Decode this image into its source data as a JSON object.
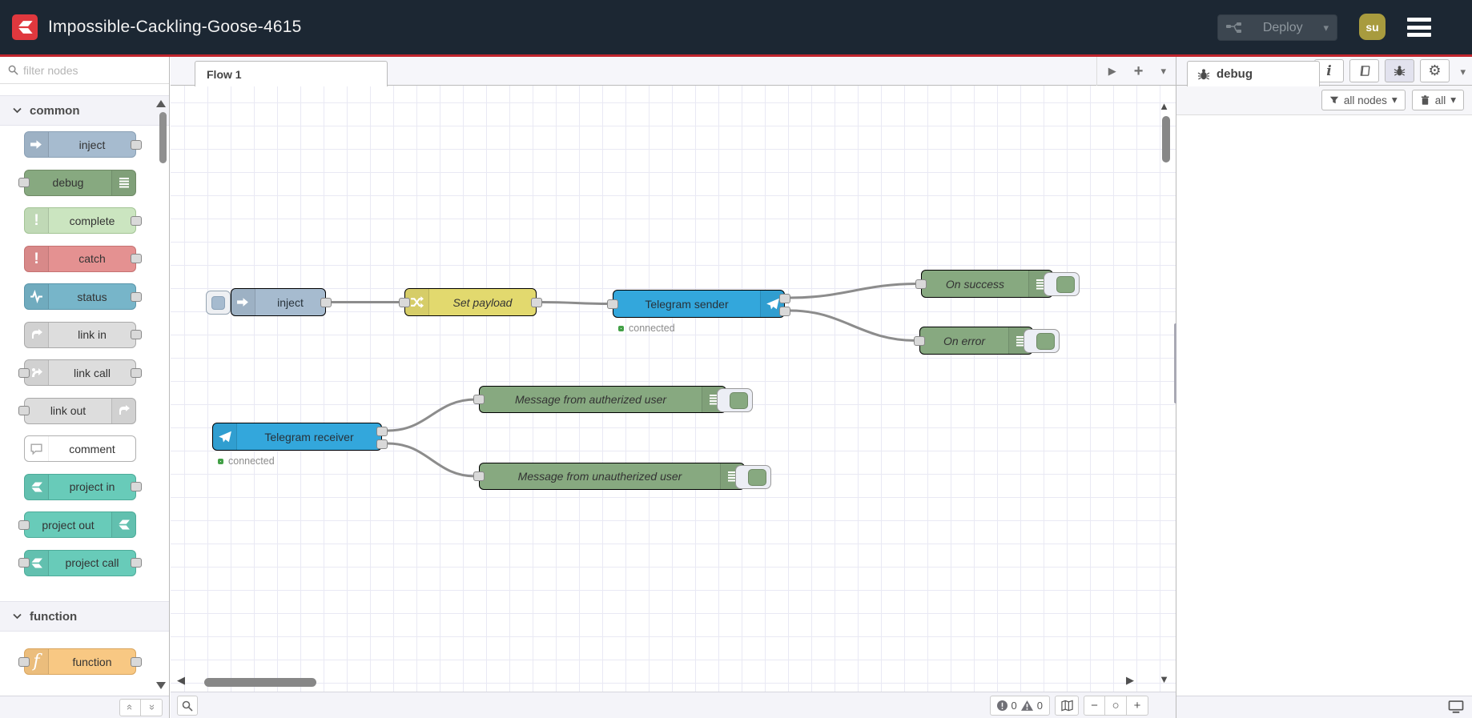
{
  "header": {
    "title": "Impossible-Cackling-Goose-4615",
    "deploy": {
      "label": "Deploy"
    },
    "user": {
      "initials": "su"
    },
    "colors": {
      "background": "#1c2733",
      "accent_line": "#c1252d",
      "logo_red": "#e0383e",
      "avatar": "#a89b3e"
    }
  },
  "palette": {
    "filter": {
      "placeholder": "filter nodes"
    },
    "sections": [
      {
        "label": "common",
        "items": [
          {
            "label": "inject",
            "color": "#a6bbcf"
          },
          {
            "label": "debug",
            "color": "#87a980"
          },
          {
            "label": "complete",
            "color": "#cbe5c0"
          },
          {
            "label": "catch",
            "color": "#e49191"
          },
          {
            "label": "status",
            "color": "#77b5c9"
          },
          {
            "label": "link in",
            "color": "#dddddd"
          },
          {
            "label": "link call",
            "color": "#dddddd"
          },
          {
            "label": "link out",
            "color": "#dddddd"
          },
          {
            "label": "comment",
            "color": "#ffffff"
          },
          {
            "label": "project in",
            "color": "#68cbb9"
          },
          {
            "label": "project out",
            "color": "#68cbb9"
          },
          {
            "label": "project call",
            "color": "#68cbb9"
          }
        ]
      },
      {
        "label": "function",
        "items": [
          {
            "label": "function",
            "color": "#f8c883"
          }
        ]
      }
    ]
  },
  "workspace": {
    "tabs": [
      {
        "label": "Flow 1"
      }
    ],
    "nodes": [
      {
        "label": "inject",
        "color": "#a6bbcf"
      },
      {
        "label": "Set payload",
        "color": "#e2d96e"
      },
      {
        "label": "Telegram sender",
        "color": "#33a7dc",
        "status": "connected"
      },
      {
        "label": "On success",
        "color": "#87a980"
      },
      {
        "label": "On error",
        "color": "#87a980"
      },
      {
        "label": "Telegram receiver",
        "color": "#33a7dc",
        "status": "connected"
      },
      {
        "label": "Message from autherized user",
        "color": "#87a980"
      },
      {
        "label": "Message from unautherized user",
        "color": "#87a980"
      }
    ],
    "footer": {
      "error_count": "0",
      "warning_count": "0"
    }
  },
  "sidebar": {
    "tabs": [
      {
        "label": "debug"
      }
    ],
    "toolbar": {
      "filter_label": "all nodes",
      "clear_label": "all"
    }
  },
  "icons": {
    "plus": "+",
    "caret_down": "▾",
    "chevron_double": "«",
    "minus": "−",
    "circle": "○",
    "left": "◀",
    "right": "▶",
    "up": "▲",
    "down": "▼",
    "gear": "⚙",
    "info": "i"
  }
}
